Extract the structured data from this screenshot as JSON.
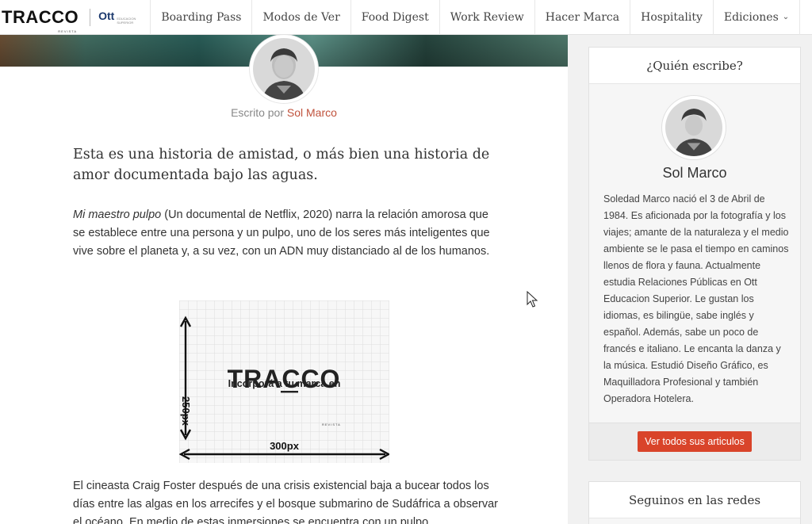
{
  "nav": {
    "logo_text": "TRACCO",
    "logo_sub": "REVISTA",
    "partner_logo": "Ott",
    "partner_sub": "EDUCACION SUPERIOR",
    "items": [
      {
        "label": "Boarding Pass"
      },
      {
        "label": "Modos de Ver"
      },
      {
        "label": "Food Digest"
      },
      {
        "label": "Work Review"
      },
      {
        "label": "Hacer Marca"
      },
      {
        "label": "Hospitality"
      },
      {
        "label": "Ediciones",
        "icon": "chevron-down-icon"
      }
    ],
    "search_icon": "search-icon"
  },
  "article": {
    "byline_prefix": "Escrito por",
    "author": "Sol Marco",
    "lead": "Esta es una historia de amistad, o más bien una historia de amor documentada bajo las aguas.",
    "para1_italic": "Mi maestro pulpo",
    "para1_rest": " (Un documental de Netflix, 2020) narra la relación amorosa que se establece entre una persona y un pulpo, uno de los seres más inteligentes que vive sobre el planeta y, a su vez, con un ADN muy distanciado al de los humanos.",
    "promo": {
      "headline": "Incorporá a tu marca en",
      "brand": "TRACCO",
      "brand_sub": "REVISTA",
      "height_label": "250px",
      "width_label": "300px"
    },
    "para2": "El cineasta Craig Foster después de una crisis existencial baja a bucear todos los días entre las algas en los arrecifes y el bosque submarino de Sudáfrica a observar el océano. En medio de estas inmersiones se encuentra con un pulpo"
  },
  "sidebar": {
    "author_widget": {
      "title": "¿Quién escribe?",
      "name": "Sol Marco",
      "bio": "Soledad Marco nació el 3 de Abril de 1984. Es aficionada por la fotografía y los viajes; amante de la naturaleza y el medio ambiente se le pasa el tiempo en caminos llenos de flora y fauna. Actualmente estudia Relaciones Públicas en Ott Educacion Superior. Le gustan los idiomas, es bilingüe, sabe inglés y español. Además, sabe un poco de francés e italiano. Le encanta la danza y la música. Estudió Diseño Gráfico, es Maquilladora Profesional y también Operadora Hotelera.",
      "button": "Ver todos sus articulos"
    },
    "social_widget": {
      "title": "Seguinos en las redes"
    }
  },
  "colors": {
    "accent": "#d9442a",
    "author_link": "#c0523c"
  }
}
